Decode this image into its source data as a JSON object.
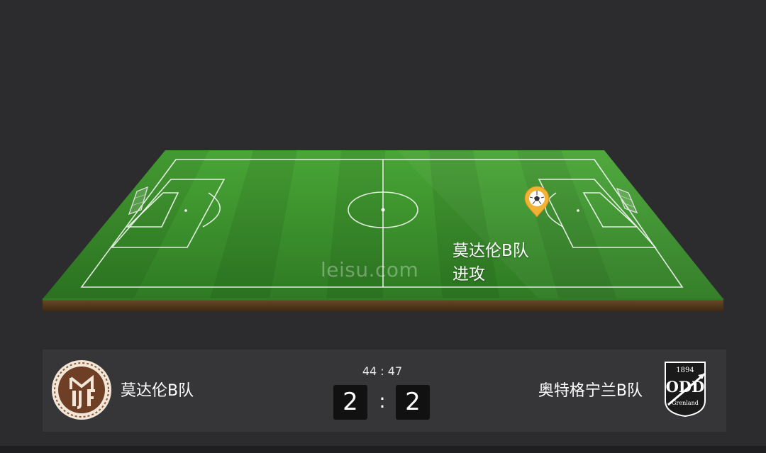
{
  "pitch": {
    "watermark": "leisu.com",
    "attack": {
      "team": "莫达伦B队",
      "action": "进攻"
    }
  },
  "match": {
    "clock": "44 : 47",
    "separator": ":",
    "home": {
      "name": "莫达伦B队",
      "score": "2",
      "logo_text": "M I F",
      "logo_icon": "mjondalen-crest"
    },
    "away": {
      "name": "奥特格宁兰B队",
      "score": "2",
      "logo_year": "1894",
      "logo_main": "ODD",
      "logo_sub": "Grenland",
      "logo_icon": "odd-grenland-crest"
    }
  },
  "colors": {
    "background": "#2c2c2e",
    "panel": "#363638",
    "grass_dark": "#2f7d26",
    "grass_light": "#45a135",
    "marker": "#f2b233"
  }
}
